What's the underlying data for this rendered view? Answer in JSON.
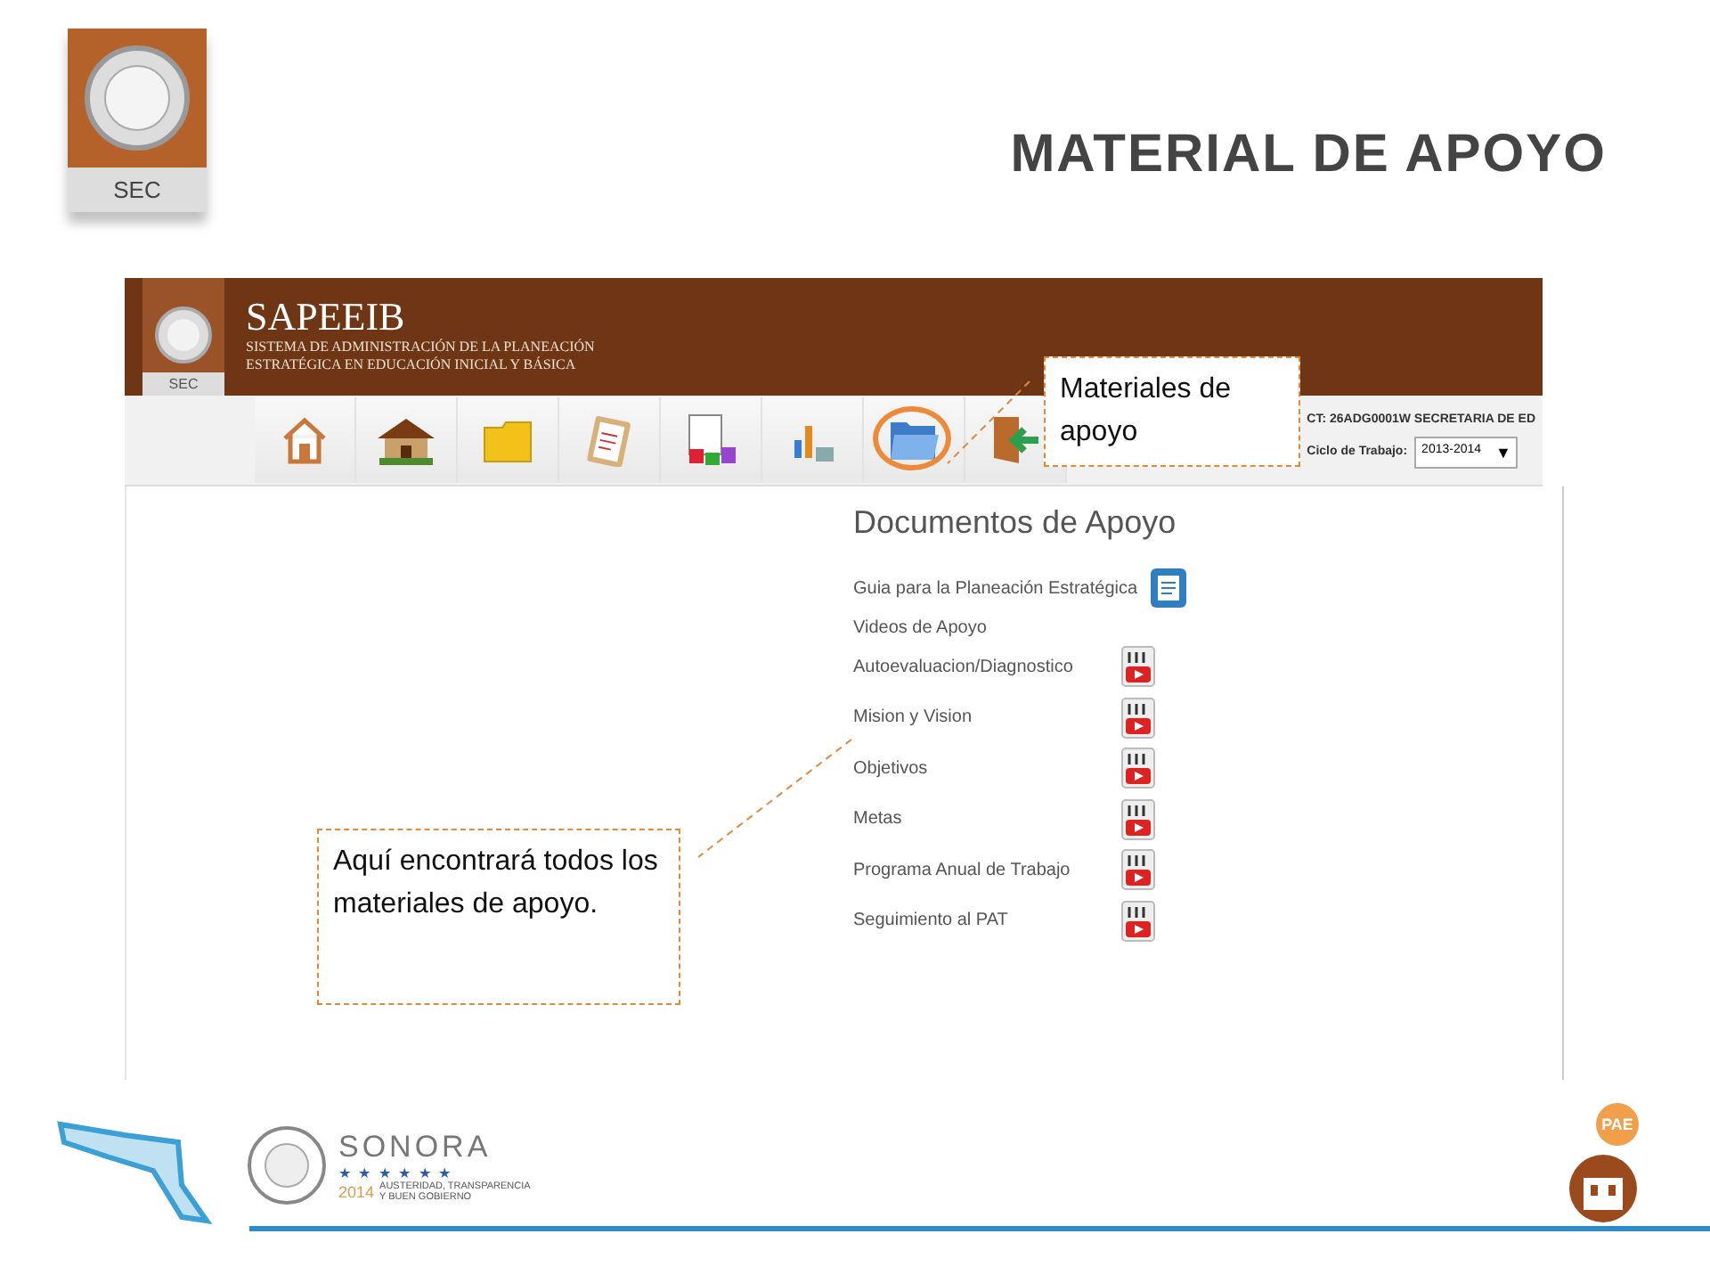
{
  "slide": {
    "logo_label": "SEC",
    "title": "MATERIAL DE APOYO"
  },
  "app": {
    "name": "SAPEEIB",
    "subtitle_1": "SISTEMA DE ADMINISTRACIÓN DE LA PLANEACIÓN",
    "subtitle_2": "ESTRATÉGICA EN EDUCACIÓN INICIAL Y BÁSICA",
    "logo_label": "SEC",
    "toolbar": [
      {
        "kind": "home",
        "circled": false
      },
      {
        "kind": "house",
        "circled": false
      },
      {
        "kind": "folder",
        "circled": false
      },
      {
        "kind": "clipboard",
        "circled": false
      },
      {
        "kind": "documents",
        "circled": false
      },
      {
        "kind": "chart",
        "circled": false
      },
      {
        "kind": "open-folder",
        "circled": true
      },
      {
        "kind": "exit",
        "circled": false
      }
    ],
    "ct": "CT: 26ADG0001W  SECRETARIA DE ED",
    "cycle_label": "Ciclo de Trabajo:",
    "cycle_value": "2013-2014",
    "cycle_caret": "▼",
    "heading": "Documentos de Apoyo",
    "documents": [
      {
        "label": "Guia para la Planeación Estratégica",
        "kind": "word"
      },
      {
        "label": "Videos de Apoyo",
        "kind": "heading"
      },
      {
        "label": "Autoevaluacion/Diagnostico",
        "kind": "video"
      },
      {
        "label": "Mision y Vision",
        "kind": "video"
      },
      {
        "label": "Objetivos",
        "kind": "video"
      },
      {
        "label": "Metas",
        "kind": "video"
      },
      {
        "label": "Programa Anual de Trabajo",
        "kind": "video"
      },
      {
        "label": "Seguimiento al PAT",
        "kind": "video"
      }
    ]
  },
  "callouts": [
    {
      "text": "Materiales de apoyo"
    },
    {
      "text": "Aquí encontrará todos los materiales de apoyo."
    }
  ],
  "footer": {
    "state": "SONORA",
    "stars": "★ ★ ★ ★ ★ ★",
    "year": "2014",
    "motto_1": "AUSTERIDAD, TRANSPARENCIA",
    "motto_2": "Y BUEN GOBIERNO",
    "badge": "PAE"
  }
}
